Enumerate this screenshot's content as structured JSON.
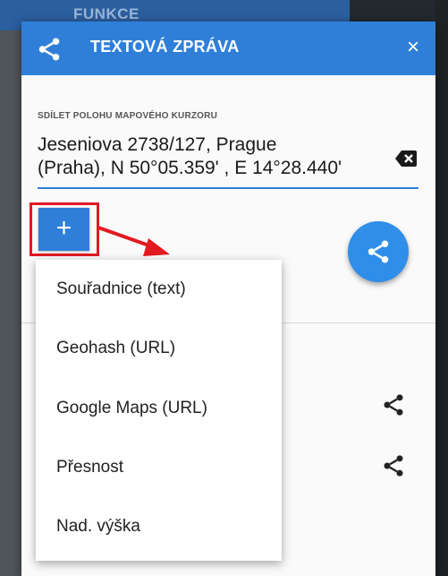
{
  "background": {
    "title": "FUNKCE"
  },
  "dialog": {
    "title": "TEXTOVÁ ZPRÁVA",
    "close_label": "×",
    "header_color": "#2f7fd9"
  },
  "field": {
    "label": "SDÍLET POLOHU MAPOVÉHO KURZORU",
    "value": "Jeseniova 2738/127, Prague\n(Praha), N 50°05.359' , E 14°28.440'"
  },
  "add_button": {
    "label": "+"
  },
  "menu": {
    "items": [
      {
        "label": "Souřadnice (text)"
      },
      {
        "label": "Geohash (URL)"
      },
      {
        "label": "Google Maps (URL)"
      },
      {
        "label": "Přesnost"
      },
      {
        "label": "Nad. výška"
      }
    ]
  },
  "icons": {
    "header": "share-icon",
    "fab": "share-icon",
    "clear": "backspace-icon",
    "rows": [
      "share-icon",
      "share-icon"
    ]
  },
  "colors": {
    "accent": "#2f7fd9",
    "highlight": "#e21a22"
  }
}
